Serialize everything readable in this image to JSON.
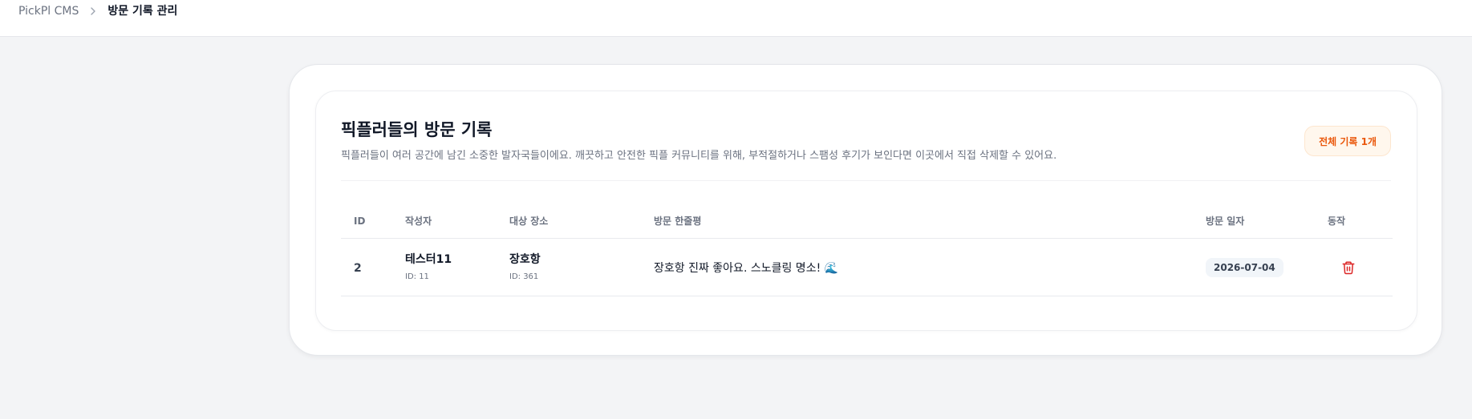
{
  "breadcrumb": {
    "root": "PickPl CMS",
    "current": "방문 기록 관리"
  },
  "page": {
    "title": "픽플러들의 방문 기록",
    "description": "픽플러들이 여러 공간에 남긴 소중한 발자국들이에요. 깨끗하고 안전한 픽플 커뮤니티를 위해, 부적절하거나 스팸성 후기가 보인다면 이곳에서 직접 삭제할 수 있어요.",
    "total_badge": "전체 기록 1개"
  },
  "table": {
    "columns": {
      "id": "ID",
      "author": "작성자",
      "place": "대상 장소",
      "review": "방문 한줄평",
      "date": "방문 일자",
      "action": "동작"
    },
    "rows": [
      {
        "id": "2",
        "author_name": "테스터11",
        "author_id": "ID: 11",
        "place_name": "장호항",
        "place_id": "ID: 361",
        "review": "장호항 진짜 좋아요. 스노클링 명소! 🌊",
        "date": "2026-07-04",
        "action_icon": "trash-icon"
      }
    ]
  },
  "colors": {
    "accent_orange": "#ea580c",
    "badge_bg": "#fff7ed",
    "delete_red": "#dc2626",
    "page_bg": "#f3f4f6"
  }
}
